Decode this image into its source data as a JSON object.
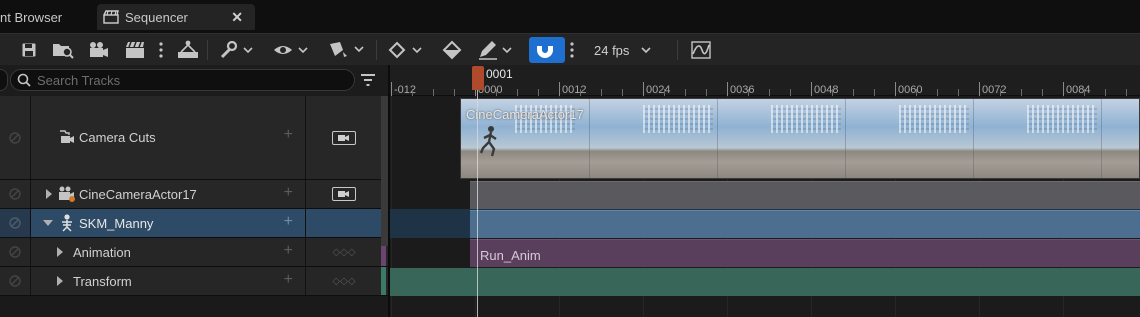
{
  "tabs": [
    {
      "label": "nt Browser",
      "active": false
    },
    {
      "label": "Sequencer",
      "active": true,
      "close": "✕"
    }
  ],
  "toolbar": {
    "icons": [
      "save-icon",
      "find-in-browser-icon",
      "camera-icon",
      "clapboard-icon",
      "more-icon",
      "hierarchy-icon",
      "wrench-icon",
      "eye-icon",
      "actor-icon",
      "key-diamond-icon",
      "fill-icon",
      "pencil-icon",
      "magnet-icon",
      "more-icon",
      "curve-editor-icon"
    ],
    "fps_label": "24 fps",
    "snap_enabled": true,
    "accent": "#1f6fd0"
  },
  "search": {
    "placeholder": "Search Tracks"
  },
  "tracks": [
    {
      "label": "Camera Cuts",
      "icon": "camera-cuts-icon",
      "has_camera_badge": true
    },
    {
      "label": "CineCameraActor17",
      "icon": "cine-camera-icon",
      "has_camera_badge": true,
      "expandable": true
    },
    {
      "label": "SKM_Manny",
      "icon": "skeleton-icon",
      "expanded": true,
      "selected": true
    },
    {
      "label": "Animation",
      "child": true,
      "keys": "◇◇◇"
    },
    {
      "label": "Transform",
      "child": true,
      "keys": "◇◇◇"
    }
  ],
  "ruler": {
    "playhead_label": "0001",
    "labels": [
      "-012",
      "0000",
      "0012",
      "0024",
      "0036",
      "0048",
      "0060",
      "0072",
      "0084"
    ]
  },
  "clips": {
    "camera_cut": "CineCameraActor17",
    "animation": "Run_Anim"
  },
  "colors": {
    "playhead": "#b04a2c",
    "camera_row": "#5a5a5e",
    "skeletal_row": "#4d6f8f",
    "animation_row": "#5a3f5d",
    "transform_row": "#386659"
  }
}
